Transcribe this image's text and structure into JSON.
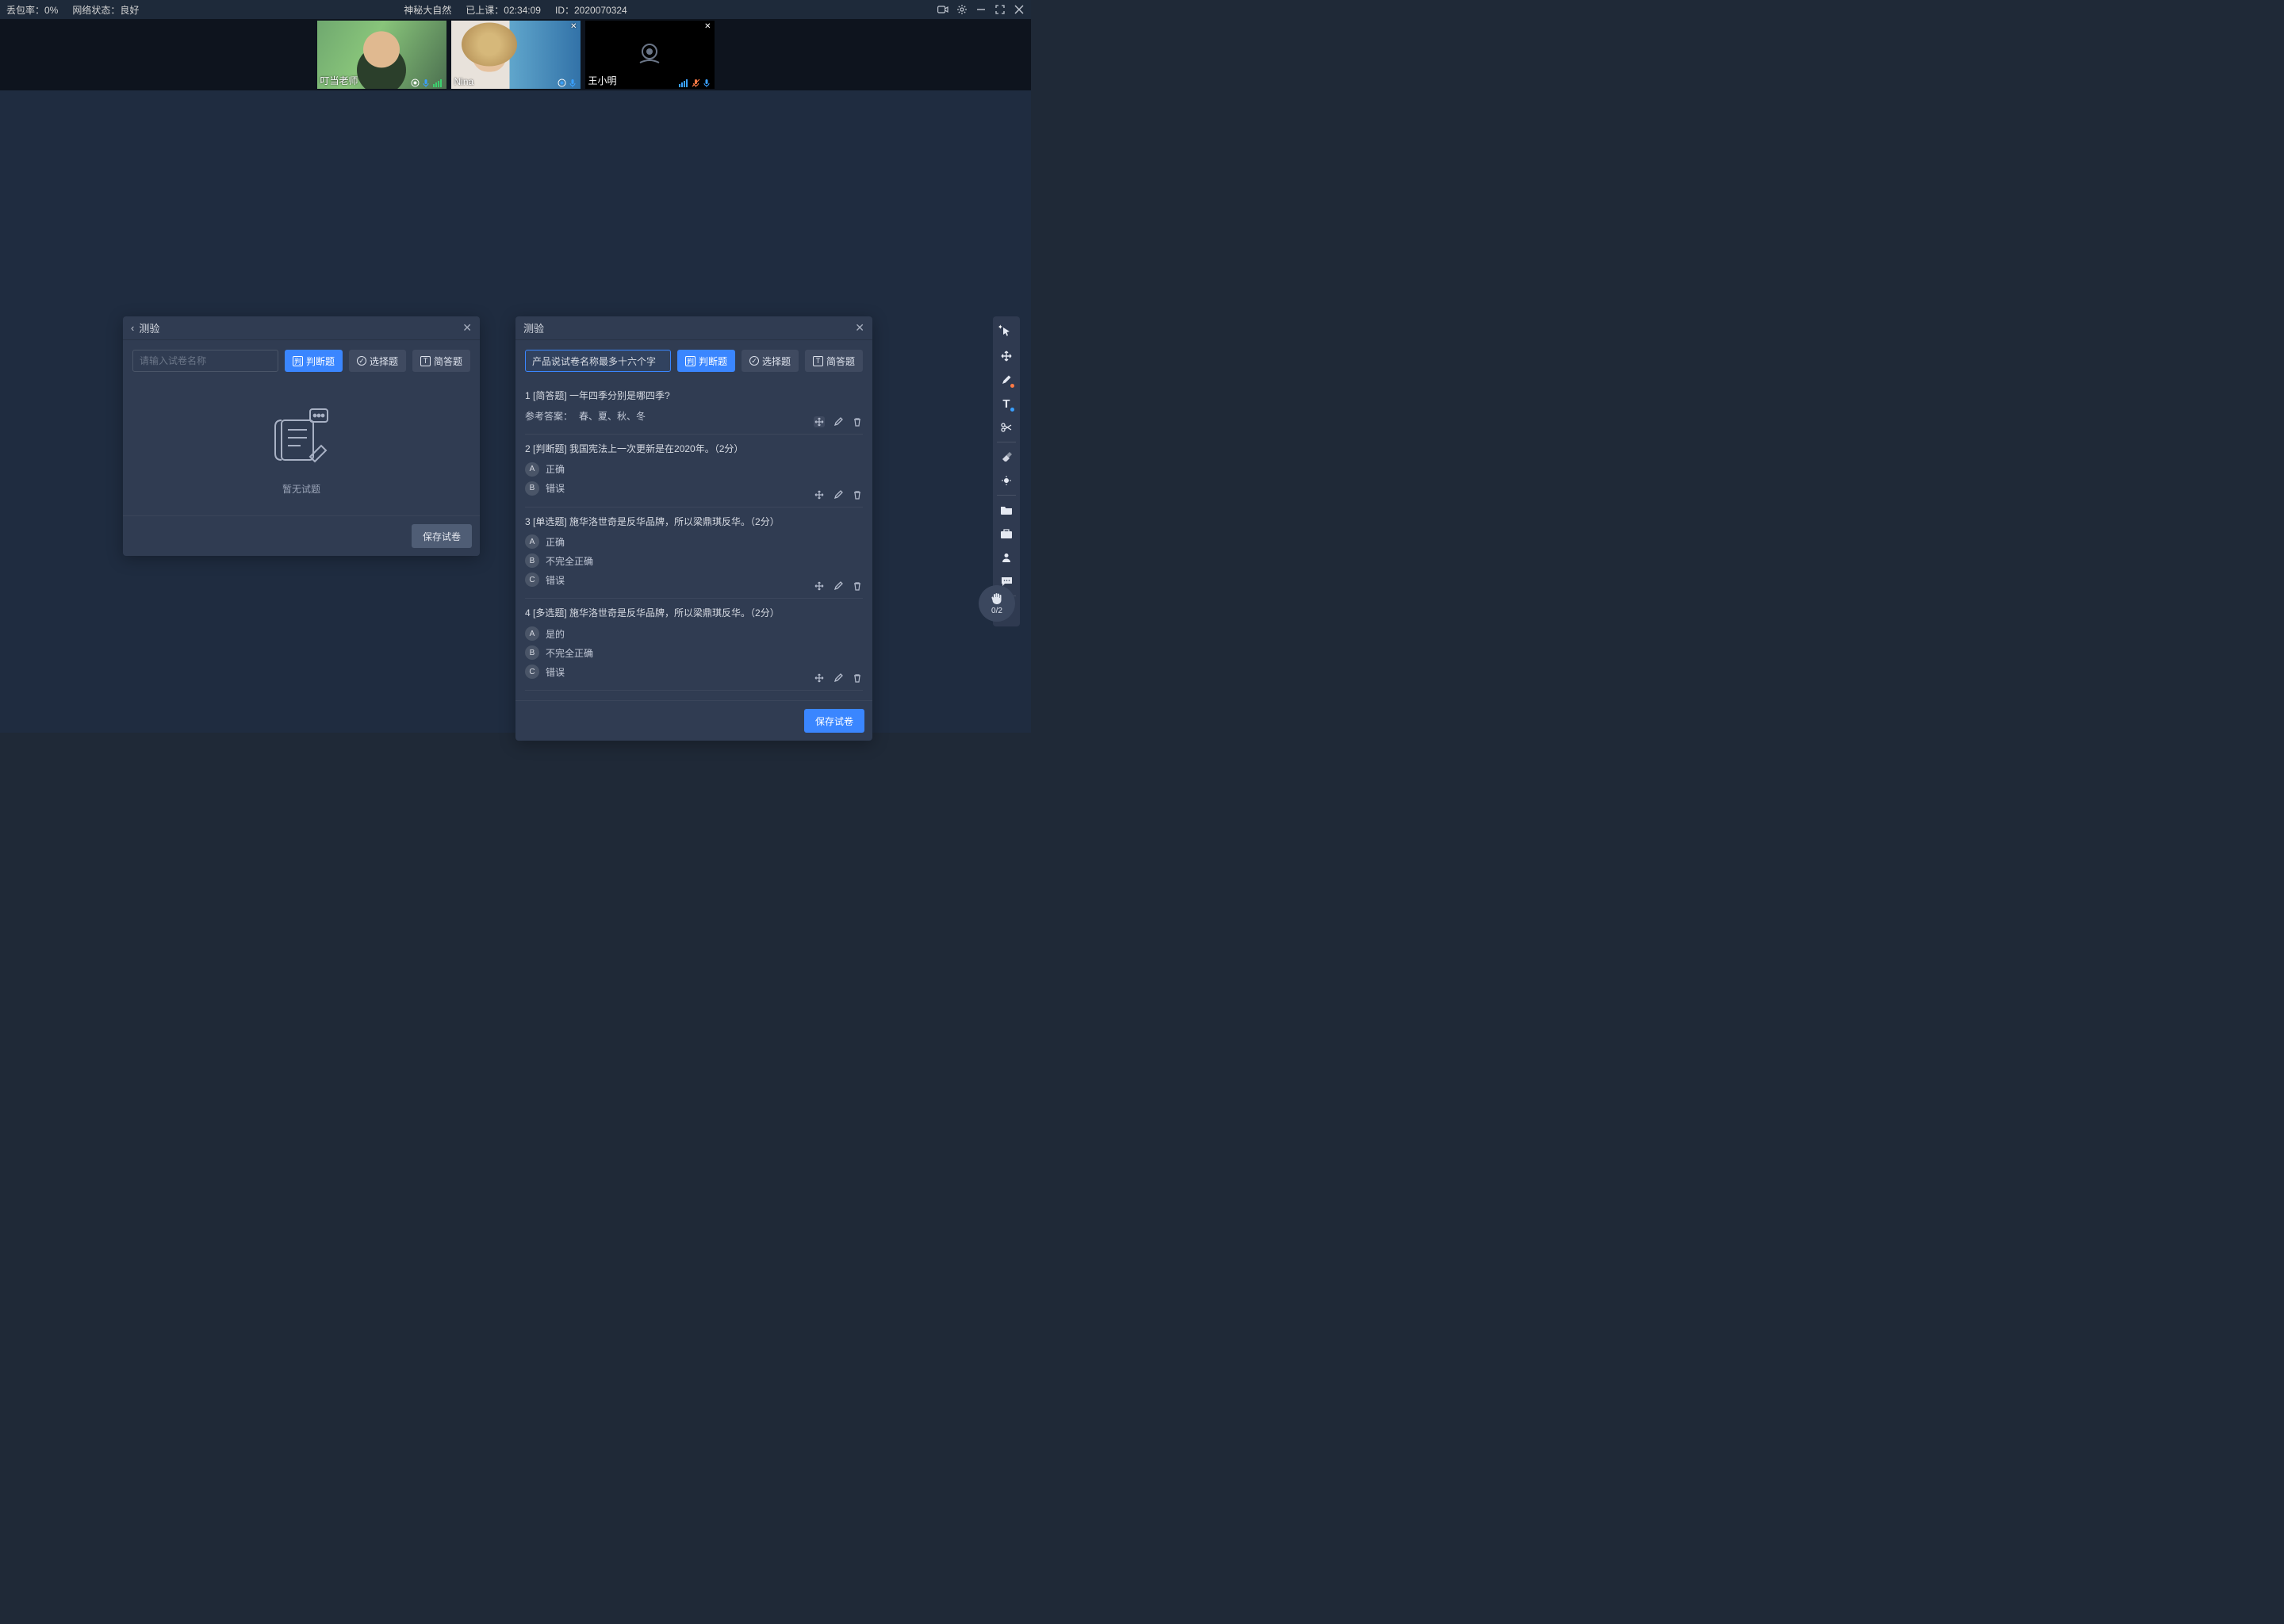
{
  "topbar": {
    "packet_loss_label": "丢包率：0%",
    "network_label": "网络状态：良好",
    "title": "神秘大自然",
    "elapsed_label": "已上课：02:34:09",
    "id_label": "ID：2020070324"
  },
  "videos": [
    {
      "name": "叮当老师",
      "camera_off": false,
      "closeable": false,
      "tile": "teacher"
    },
    {
      "name": "Nina",
      "camera_off": false,
      "closeable": true,
      "tile": "nina"
    },
    {
      "name": "王小明",
      "camera_off": true,
      "closeable": true,
      "tile": "off",
      "muted_cam": true
    }
  ],
  "panel_left": {
    "title": "测验",
    "input_placeholder": "请输入试卷名称",
    "btn_tf": "判断题",
    "btn_choice": "选择题",
    "btn_short": "简答题",
    "empty_text": "暂无试题",
    "save_label": "保存试卷"
  },
  "panel_right": {
    "title": "测验",
    "input_value": "产品说试卷名称最多十六个字",
    "btn_tf": "判断题",
    "btn_choice": "选择题",
    "btn_short": "简答题",
    "save_label": "保存试卷",
    "answer_prefix": "参考答案：",
    "questions": [
      {
        "num": "1",
        "text": "[简答题] 一年四季分别是哪四季?",
        "answer": "春、夏、秋、冬"
      },
      {
        "num": "2",
        "text": "[判断题] 我国宪法上一次更新是在2020年。（2分）",
        "options": [
          {
            "k": "A",
            "v": "正确"
          },
          {
            "k": "B",
            "v": "错误"
          }
        ]
      },
      {
        "num": "3",
        "text": "[单选题] 施华洛世奇是反华品牌，所以梁鼎琪反华。（2分）",
        "options": [
          {
            "k": "A",
            "v": "正确"
          },
          {
            "k": "B",
            "v": "不完全正确"
          },
          {
            "k": "C",
            "v": "错误"
          }
        ]
      },
      {
        "num": "4",
        "text": "[多选题] 施华洛世奇是反华品牌，所以梁鼎琪反华。（2分）",
        "options": [
          {
            "k": "A",
            "v": "是的"
          },
          {
            "k": "B",
            "v": "不完全正确"
          },
          {
            "k": "C",
            "v": "错误"
          }
        ]
      }
    ]
  },
  "hand_fab": {
    "count": "0/2"
  }
}
